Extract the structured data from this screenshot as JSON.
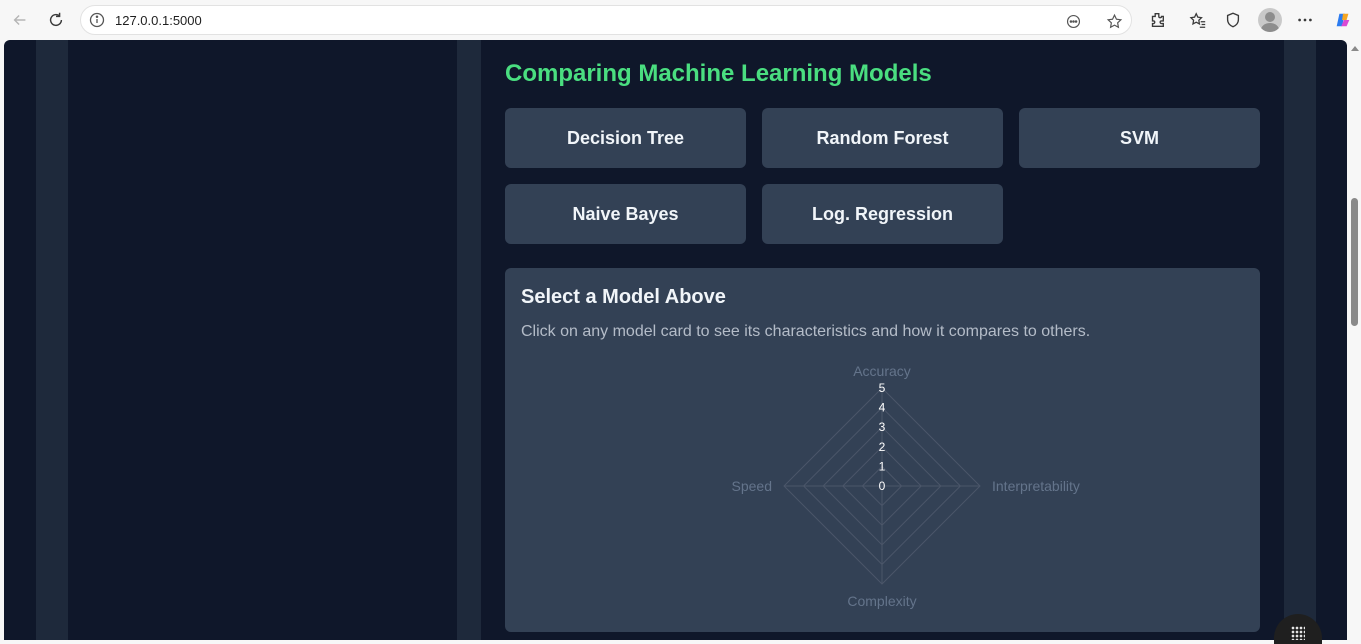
{
  "browser": {
    "url": "127.0.0.1:5000",
    "icons": [
      "back-icon",
      "refresh-icon",
      "site-info-icon",
      "reading-mode-icon",
      "favorite-star-icon",
      "extensions-icon",
      "favorites-icon",
      "browser-essentials-icon",
      "profile-avatar",
      "more-icon",
      "copilot-icon"
    ]
  },
  "main": {
    "title": "Comparing Machine Learning Models",
    "models": [
      {
        "label": "Decision Tree"
      },
      {
        "label": "Random Forest"
      },
      {
        "label": "SVM"
      },
      {
        "label": "Naive Bayes"
      },
      {
        "label": "Log. Regression"
      }
    ],
    "panel": {
      "title": "Select a Model Above",
      "description": "Click on any model card to see its characteristics and how it compares to others."
    }
  },
  "chart_data": {
    "type": "radar",
    "axes": [
      "Accuracy",
      "Interpretability",
      "Complexity",
      "Speed"
    ],
    "ticks": [
      "0",
      "1",
      "2",
      "3",
      "4",
      "5"
    ],
    "range": [
      0,
      5
    ],
    "series": []
  },
  "colors": {
    "page_bg": "#0f172a",
    "column_bg": "#1e293b",
    "card_bg": "#334155",
    "title_accent": "#4ade80",
    "text_primary": "#f1f5f9",
    "text_muted": "#b4bcc8",
    "radar_grid": "#4b5669",
    "radar_label": "#64748b"
  }
}
